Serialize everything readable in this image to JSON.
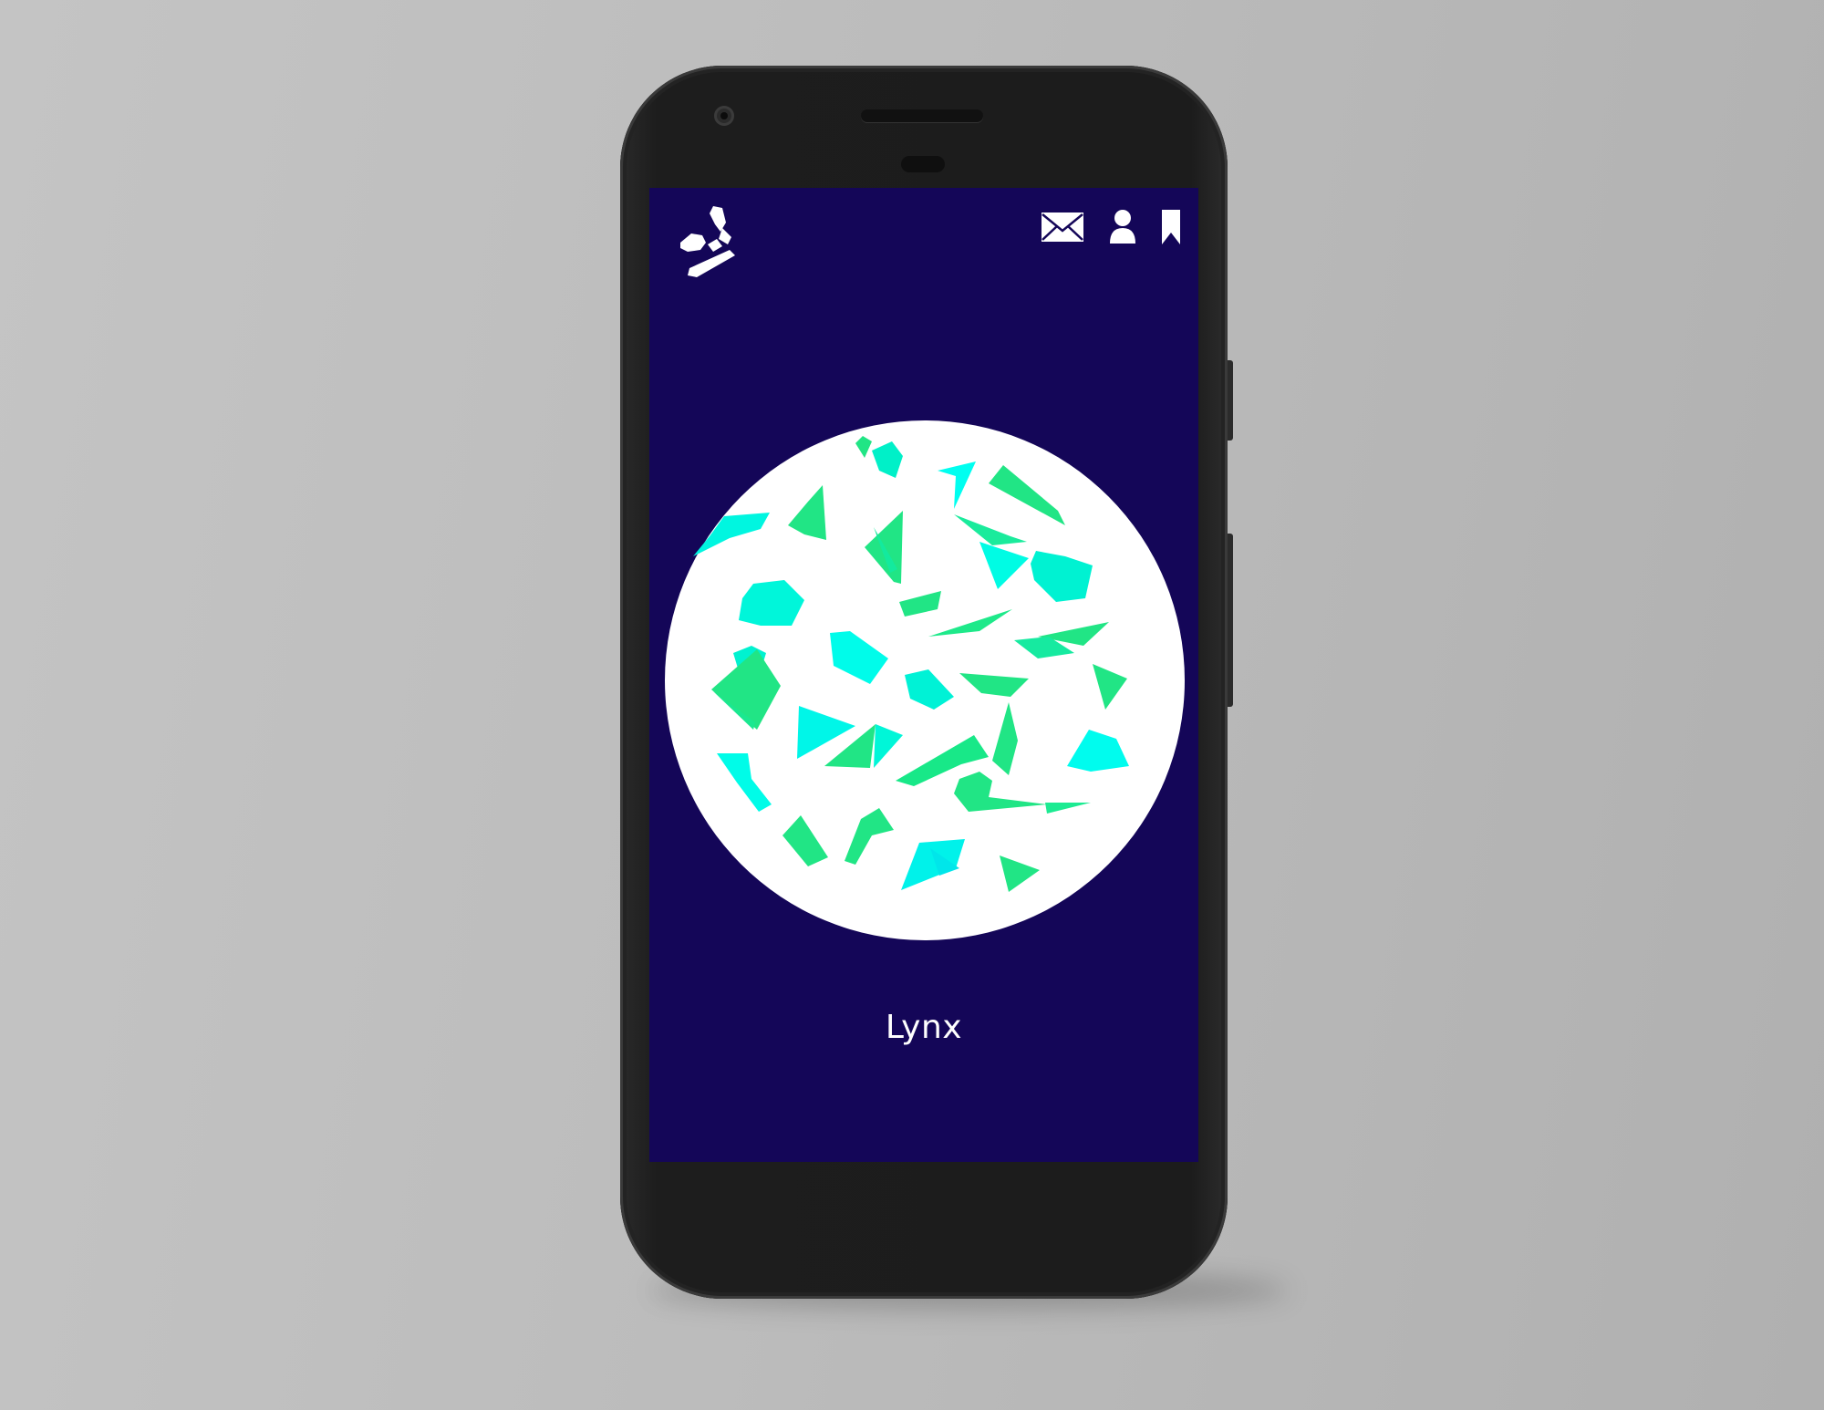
{
  "screen": {
    "background_color": "#140658",
    "orb_color": "#ffffff",
    "shard_gradient": [
      "#00ffee",
      "#21e585"
    ],
    "caption": "Lynx"
  },
  "topbar": {
    "logo_icon": "shard-logo-icon",
    "actions": [
      {
        "icon": "mail-icon"
      },
      {
        "icon": "user-icon"
      },
      {
        "icon": "bookmark-icon"
      }
    ]
  }
}
